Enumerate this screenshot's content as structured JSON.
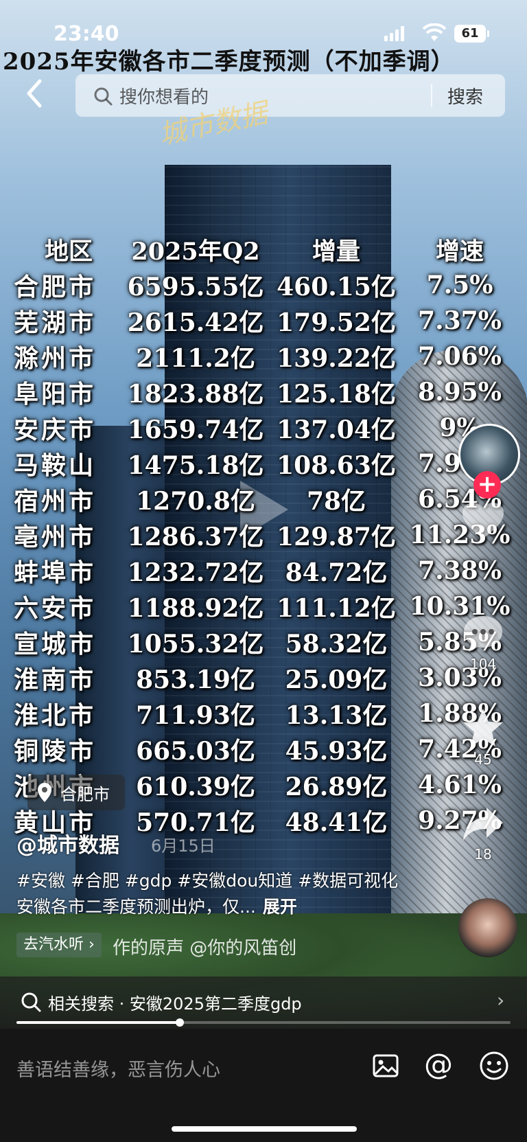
{
  "status_bar": {
    "time": "23:40",
    "battery": "61"
  },
  "video": {
    "title": "2025年安徽各市二季度预测（不加季调）",
    "watermark": "城市数据",
    "table": {
      "headers": [
        "地区",
        "2025年Q2",
        "增量",
        "增速"
      ],
      "rows": [
        [
          "合肥市",
          "6595.55亿",
          "460.15亿",
          "7.5%"
        ],
        [
          "芜湖市",
          "2615.42亿",
          "179.52亿",
          "7.37%"
        ],
        [
          "滁州市",
          "2111.2亿",
          "139.22亿",
          "7.06%"
        ],
        [
          "阜阳市",
          "1823.88亿",
          "125.18亿",
          "8.95%"
        ],
        [
          "安庆市",
          "1659.74亿",
          "137.04亿",
          "9%"
        ],
        [
          "马鞍山",
          "1475.18亿",
          "108.63亿",
          "7.95%"
        ],
        [
          "宿州市",
          "1270.8亿",
          "78亿",
          "6.54%"
        ],
        [
          "亳州市",
          "1286.37亿",
          "129.87亿",
          "11.23%"
        ],
        [
          "蚌埠市",
          "1232.72亿",
          "84.72亿",
          "7.38%"
        ],
        [
          "六安市",
          "1188.92亿",
          "111.12亿",
          "10.31%"
        ],
        [
          "宣城市",
          "1055.32亿",
          "58.32亿",
          "5.85%"
        ],
        [
          "淮南市",
          "853.19亿",
          "25.09亿",
          "3.03%"
        ],
        [
          "淮北市",
          "711.93亿",
          "13.13亿",
          "1.88%"
        ],
        [
          "铜陵市",
          "665.03亿",
          "45.93亿",
          "7.42%"
        ],
        [
          "池州市",
          "610.39亿",
          "26.89亿",
          "4.61%"
        ],
        [
          "黄山市",
          "570.71亿",
          "48.41亿",
          "9.27%"
        ]
      ]
    }
  },
  "search": {
    "placeholder": "搜你想看的",
    "submit_label": "搜索"
  },
  "rail": {
    "like_count": "",
    "comment_count": "104",
    "favorite_count": "45",
    "share_count": "18"
  },
  "post": {
    "location": "合肥市",
    "author": "@城市数据",
    "date": "6月15日",
    "caption": "#安徽 #合肥 #gdp #安徽dou知道 #数据可视化 安徽各市二季度预测出炉，仅...",
    "expand_label": "展开",
    "music_chip": "去汽水听 ›",
    "music_title": "作的原声    @你的风笛创"
  },
  "related_search": {
    "label": "相关搜索 · 安徽2025第二季度gdp"
  },
  "playback": {
    "progress": 0.33
  },
  "comment": {
    "placeholder": "善语结善缘，恶言伤人心"
  },
  "colors": {
    "follow": "#fe2c55",
    "comment_bar": "#161616"
  }
}
